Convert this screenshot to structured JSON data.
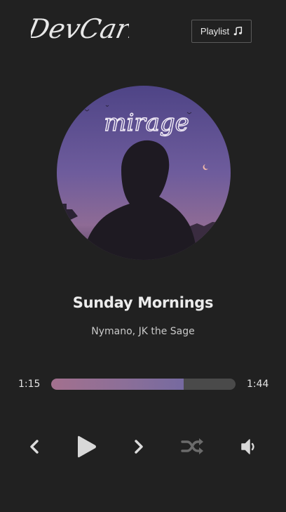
{
  "header": {
    "logo_text": "DevCarl",
    "playlist_label": "Playlist",
    "playlist_icon": "music-note-icon"
  },
  "cover": {
    "text": "mirage",
    "description_icon": "album-cover"
  },
  "track": {
    "title": "Sunday Mornings",
    "artist": "Nymano, JK the Sage"
  },
  "progress": {
    "current_time": "1:15",
    "total_time": "1:44",
    "fraction": 0.72
  },
  "controls": {
    "previous_icon": "chevron-left-icon",
    "play_icon": "play-icon",
    "next_icon": "chevron-right-icon",
    "shuffle_icon": "shuffle-icon",
    "volume_icon": "volume-icon"
  },
  "colors": {
    "background": "#212121",
    "progress_start": "#a3708e",
    "progress_end": "#766aa0",
    "progress_track": "#4a4a4a",
    "text": "#ececec"
  }
}
